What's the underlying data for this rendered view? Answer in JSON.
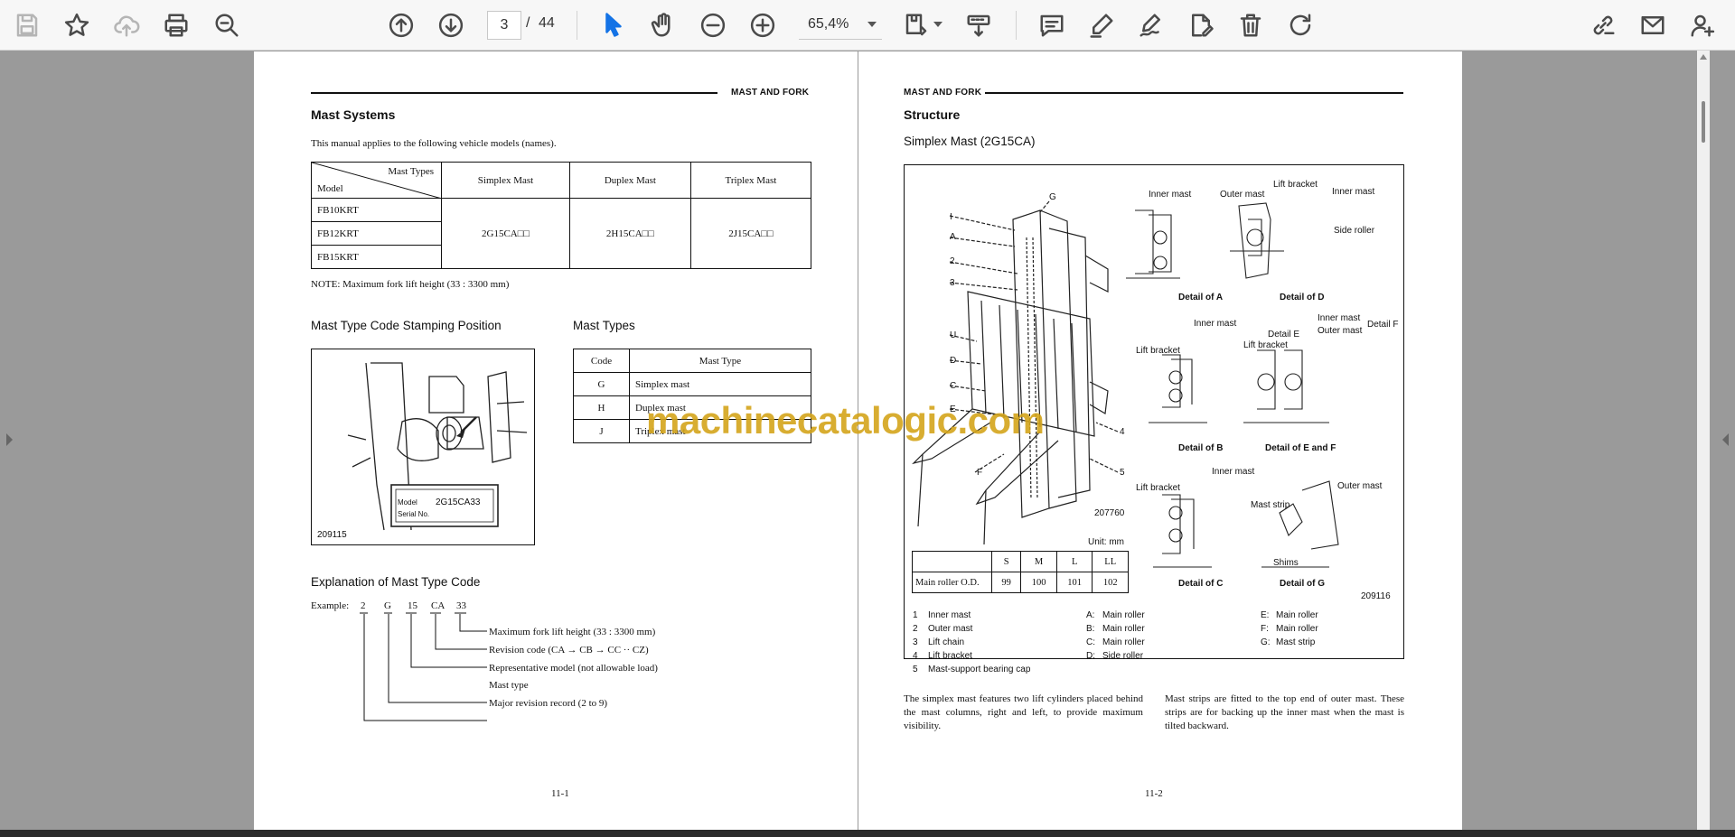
{
  "toolbar": {
    "page_current": "3",
    "page_sep": "/",
    "page_total": "44",
    "zoom": "65,4%",
    "icons": [
      "save-icon",
      "star-icon",
      "cloud-upload-icon",
      "print-icon",
      "zoom-search-icon",
      "page-up-icon",
      "page-down-icon",
      "select-cursor-icon",
      "hand-icon",
      "zoom-out-icon",
      "zoom-in-icon",
      "page-fit-icon",
      "scroll-mode-icon",
      "comment-icon",
      "highlight-icon",
      "sign-icon",
      "edit-pdf-icon",
      "delete-icon",
      "rotate-icon",
      "share-link-icon",
      "email-icon",
      "add-user-icon"
    ]
  },
  "watermark": "machinecatalogic.com",
  "left_page": {
    "header": "MAST AND FORK",
    "title": "Mast Systems",
    "intro": "This manual applies to the following vehicle models (names).",
    "models_table": {
      "corner_top": "Mast Types",
      "corner_bottom": "Model",
      "columns": [
        "Simplex Mast",
        "Duplex Mast",
        "Triplex Mast"
      ],
      "models": [
        "FB10KRT",
        "FB12KRT",
        "FB15KRT"
      ],
      "codes": [
        "2G15CA□□",
        "2H15CA□□",
        "2J15CA□□"
      ]
    },
    "note": "NOTE: Maximum fork lift height (33 : 3300 mm)",
    "stamping_title": "Mast Type Code Stamping Position",
    "stamping_plate_line1": "Model",
    "stamping_plate_code": "2G15CA33",
    "stamping_plate_line2": "Serial No.",
    "stamping_fig_no": "209115",
    "mast_types_title": "Mast Types",
    "mast_types_table": {
      "headers": [
        "Code",
        "Mast Type"
      ],
      "rows": [
        [
          "G",
          "Simplex mast"
        ],
        [
          "H",
          "Duplex mast"
        ],
        [
          "J",
          "Triplex mast"
        ]
      ]
    },
    "explanation_title": "Explanation of Mast Type Code",
    "example_label": "Example:",
    "example_parts": [
      "2",
      "G",
      "15",
      "CA",
      "33"
    ],
    "explanation_lines": [
      "Maximum fork lift height (33 : 3300 mm)",
      "Revision code (CA → CB → CC ·· CZ)",
      "Representative model (not allowable load)",
      "Mast type",
      "Major revision record (2 to 9)"
    ],
    "page_number": "11-1"
  },
  "right_page": {
    "header": "MAST AND FORK",
    "title": "Structure",
    "subtitle": "Simplex Mast (2G15CA)",
    "fig_no_main": "207760",
    "fig_no_box": "209116",
    "unit": "Unit: mm",
    "callouts_left": [
      "I",
      "A",
      "2",
      "3",
      "U",
      "D",
      "C",
      "E",
      "F"
    ],
    "callouts_right": [
      "G",
      "4",
      "5"
    ],
    "details": [
      {
        "caption": "Detail of A",
        "labels": [
          "Inner mast",
          "Outer mast"
        ]
      },
      {
        "caption": "Detail of D",
        "labels": [
          "Lift bracket",
          "Inner mast",
          "Side roller"
        ]
      },
      {
        "caption": "Detail of B",
        "labels": [
          "Inner mast",
          "Lift bracket"
        ]
      },
      {
        "caption": "Detail of E and F",
        "labels": [
          "Detail E",
          "Lift bracket",
          "Inner mast",
          "Outer mast",
          "Detail F"
        ]
      },
      {
        "caption": "Detail of C",
        "labels": [
          "Lift bracket",
          "Inner mast"
        ]
      },
      {
        "caption": "Detail of G",
        "labels": [
          "Mast strip",
          "Outer mast",
          "Shims"
        ]
      }
    ],
    "roller_table": {
      "headers": [
        "",
        "S",
        "M",
        "L",
        "LL"
      ],
      "row": [
        "Main roller O.D.",
        "99",
        "100",
        "101",
        "102"
      ]
    },
    "legend_numbers": [
      [
        "1",
        "Inner mast"
      ],
      [
        "2",
        "Outer mast"
      ],
      [
        "3",
        "Lift chain"
      ],
      [
        "4",
        "Lift bracket"
      ],
      [
        "5",
        "Mast-support bearing cap"
      ]
    ],
    "legend_letters_1": [
      [
        "A:",
        "Main roller"
      ],
      [
        "B:",
        "Main roller"
      ],
      [
        "C:",
        "Main roller"
      ],
      [
        "D:",
        "Side roller"
      ]
    ],
    "legend_letters_2": [
      [
        "E:",
        "Main roller"
      ],
      [
        "F:",
        "Main roller"
      ],
      [
        "G:",
        "Mast strip"
      ]
    ],
    "para_left": "The simplex mast features two lift cylinders placed behind the mast columns, right and left, to provide maximum visibility.",
    "para_right": "Mast strips are fitted to the top end of outer mast. These strips are for backing up the inner mast when the mast is tilted backward.",
    "page_number": "11-2"
  }
}
